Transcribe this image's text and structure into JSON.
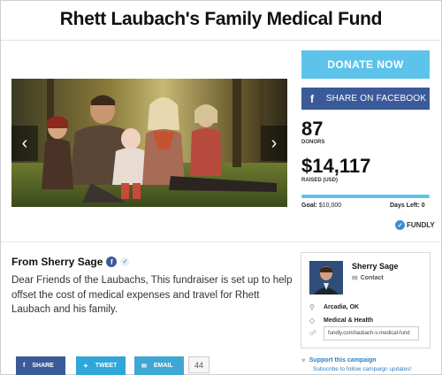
{
  "page": {
    "title": "Rhett Laubach's Family Medical Fund"
  },
  "hero": {
    "prev_label": "‹",
    "next_label": "›"
  },
  "actions": {
    "donate_label": "DONATE NOW",
    "fb_share_label": "SHARE ON FACEBOOK",
    "fb_letter": "f"
  },
  "stats": {
    "donors_count": "87",
    "donors_label": "DONORS",
    "raised_amount": "$14,117",
    "raised_label": "RAISED (USD)",
    "progress_fraction": 1.0,
    "goal_prefix": "Goal:",
    "goal_value": "$10,000",
    "days_left_label": "Days Left: 0"
  },
  "brand": {
    "fundly_label": "FUNDLY"
  },
  "story": {
    "from_label": "From Sherry Sage",
    "body": "Dear Friends of the Laubachs, This fundraiser is set up to help offset the cost of medical expenses and travel for Rhett Laubach and his family."
  },
  "share": {
    "facebook_label": "SHARE",
    "twitter_label": "TWEET",
    "email_label": "EMAIL",
    "count": "44"
  },
  "organizer": {
    "name": "Sherry Sage",
    "contact_label": "Contact",
    "location": "Arcadia, OK",
    "category": "Medical & Health",
    "url": "fundly.com/laubach-s-medical-fund"
  },
  "support": {
    "label": "Support this campaign",
    "subscribe": "Subscribe to follow campaign updates!"
  },
  "colors": {
    "accent": "#5ec3ea",
    "facebook": "#3b5a9a",
    "twitter": "#30a6d9",
    "link": "#2f7fc1"
  }
}
